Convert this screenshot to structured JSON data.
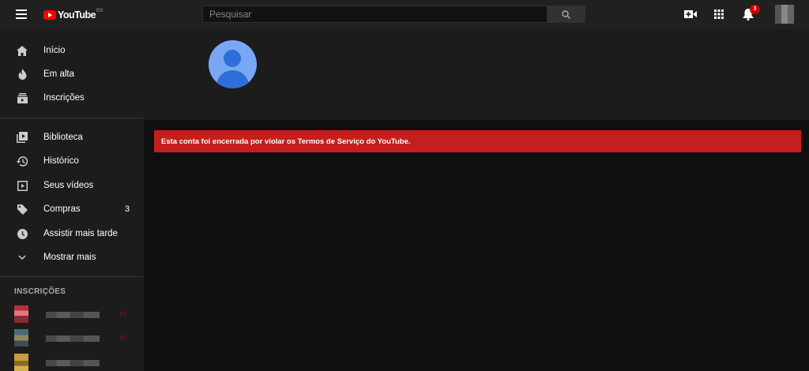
{
  "header": {
    "logo_text": "YouTube",
    "logo_country": "ES",
    "search_placeholder": "Pesquisar",
    "notification_count": "3"
  },
  "sidebar": {
    "main_items": [
      {
        "label": "Início",
        "icon": "home-icon"
      },
      {
        "label": "Em alta",
        "icon": "fire-icon"
      },
      {
        "label": "Inscrições",
        "icon": "subscriptions-icon"
      }
    ],
    "library_items": [
      {
        "label": "Biblioteca",
        "icon": "library-icon"
      },
      {
        "label": "Histórico",
        "icon": "history-icon"
      },
      {
        "label": "Seus vídeos",
        "icon": "play-square-icon"
      },
      {
        "label": "Compras",
        "icon": "tag-icon",
        "count": "3"
      },
      {
        "label": "Assistir mais tarde",
        "icon": "clock-icon"
      },
      {
        "label": "Mostrar mais",
        "icon": "chevron-down-icon"
      }
    ],
    "subscriptions_title": "INSCRIÇÕES",
    "subscriptions_live_glyph": "(•)"
  },
  "channel": {
    "termination_message": "Esta conta foi encerrada por violar os Termos de Serviço do YouTube."
  },
  "colors": {
    "alert": "#c31f1f",
    "brand": "#ff0000",
    "avatar_bg": "#7aa7f5"
  }
}
